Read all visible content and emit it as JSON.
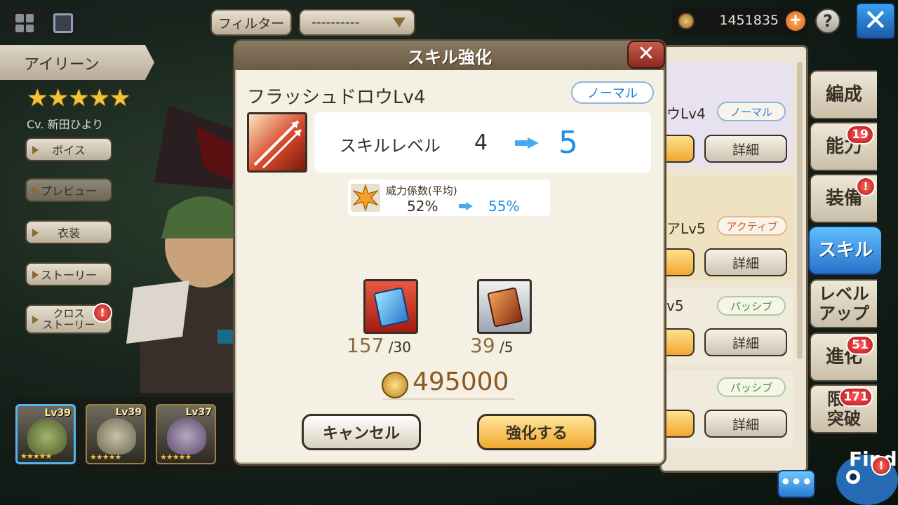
{
  "top_bar": {
    "filter_label": "フィルター",
    "filter_value": "----------",
    "currency_value": "1451835",
    "plus_label": "+",
    "help_label": "?",
    "close_label": "✕"
  },
  "character": {
    "name": "アイリーン",
    "stars": "★★★★★",
    "cv": "Cv. 新田ひより",
    "buttons": {
      "voice": "ボイス",
      "preview": "プレビュー",
      "costume": "衣装",
      "story": "ストーリー",
      "cross_story_1": "クロス",
      "cross_story_2": "ストーリー"
    },
    "alert_mark": "!"
  },
  "party": [
    {
      "level": "Lv39",
      "stars": "★★★★★"
    },
    {
      "level": "Lv39",
      "stars": "★★★★★"
    },
    {
      "level": "Lv37",
      "stars": "★★★★★"
    }
  ],
  "skill_list_bg": {
    "row1_name": "ウLv4",
    "row1_tag": "ノーマル",
    "row2_name": "アLv5",
    "row2_tag": "アクティブ",
    "row3_name": "v5",
    "row3_tag": "パッシブ",
    "row4_tag": "パッシブ",
    "detail_label": "詳細"
  },
  "tabs": {
    "formation": "編成",
    "ability": "能力",
    "ability_badge": "19",
    "equipment": "装備",
    "equipment_badge": "!",
    "skill": "スキル",
    "levelup_1": "レベル",
    "levelup_2": "アップ",
    "evolution": "進化",
    "evolution_badge": "51",
    "limit_1": "限界",
    "limit_2": "突破",
    "limit_badge": "171"
  },
  "chat_label": "•••",
  "mascot_text": "Find",
  "dialog": {
    "title": "スキル強化",
    "close_label": "✕",
    "skill_name": "フラッシュドロウLv4",
    "skill_type": "ノーマル",
    "level_label": "スキルレベル",
    "level_from": "4",
    "level_to": "5",
    "power_label": "威力係数(平均)",
    "power_from": "52%",
    "power_to": "55%",
    "materials": [
      {
        "owned": "157",
        "required": " /30"
      },
      {
        "owned": "39",
        "required": " /5"
      }
    ],
    "cost": "495000",
    "cancel_label": "キャンセル",
    "confirm_label": "強化する"
  },
  "colors": {
    "accent_blue": "#1c8fe8",
    "confirm_yellow": "#f0a830",
    "header_brown": "#6a5a44"
  }
}
